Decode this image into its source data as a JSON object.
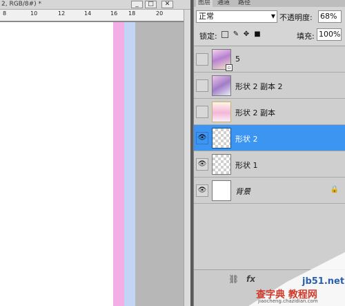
{
  "document": {
    "title": "2, RGB/8#) *",
    "ruler_labels": [
      "8",
      "10",
      "12",
      "14",
      "16",
      "18",
      "20"
    ],
    "window_buttons": [
      "_",
      "□",
      "✕"
    ]
  },
  "panel": {
    "tabs": [
      "图层",
      "通道",
      "路径"
    ],
    "blend_mode": "正常",
    "opacity_label": "不透明度:",
    "opacity_value": "68%",
    "lock_label": "锁定:",
    "fill_label": "填充:",
    "fill_value": "100%",
    "layers": [
      {
        "name": "5",
        "visible": false,
        "selected": false,
        "thumb": "photo1",
        "italic": false,
        "locked": false
      },
      {
        "name": "形状 2 副本 2",
        "visible": false,
        "selected": false,
        "thumb": "photo2",
        "italic": false,
        "locked": false
      },
      {
        "name": "形状 2 副本",
        "visible": false,
        "selected": false,
        "thumb": "photo3",
        "italic": false,
        "locked": false
      },
      {
        "name": "形状 2",
        "visible": true,
        "selected": true,
        "thumb": "checker",
        "italic": false,
        "locked": false
      },
      {
        "name": "形状 1",
        "visible": true,
        "selected": false,
        "thumb": "checker",
        "italic": false,
        "locked": false
      },
      {
        "name": "背景",
        "visible": true,
        "selected": false,
        "thumb": "white",
        "italic": true,
        "locked": true
      }
    ],
    "icons": {
      "eye": "👁",
      "lock": "🔒",
      "link": "⛓",
      "fx": "fx"
    }
  },
  "watermark": {
    "domain": "jb51.net",
    "brand": "查字典 教程网",
    "url": "jiaocheng.chazidian.com"
  }
}
